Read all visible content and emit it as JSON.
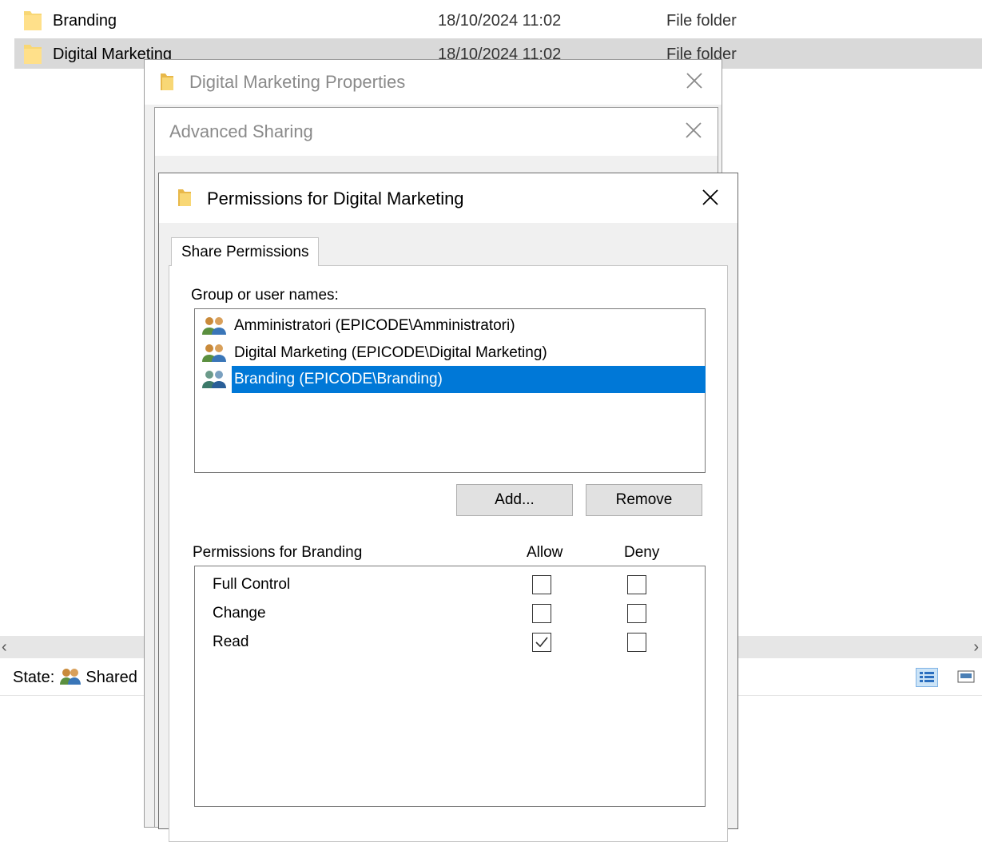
{
  "explorer": {
    "files": [
      {
        "name": "Branding",
        "date": "18/10/2024 11:02",
        "type": "File folder",
        "selected": false
      },
      {
        "name": "Digital Marketing",
        "date": "18/10/2024 11:02",
        "type": "File folder",
        "selected": true
      }
    ],
    "status": {
      "state_label": "State:",
      "state_value": "Shared"
    }
  },
  "properties_dialog": {
    "title": "Digital Marketing Properties"
  },
  "advanced_sharing_dialog": {
    "title": "Advanced Sharing"
  },
  "permissions_dialog": {
    "title": "Permissions for Digital Marketing",
    "tab": "Share Permissions",
    "group_label": "Group or user names:",
    "users": [
      {
        "name": "Amministratori (EPICODE\\Amministratori)",
        "selected": false
      },
      {
        "name": "Digital Marketing (EPICODE\\Digital Marketing)",
        "selected": false
      },
      {
        "name": "Branding (EPICODE\\Branding)",
        "selected": true
      }
    ],
    "add_button": "Add...",
    "remove_button": "Remove",
    "permissions_label": "Permissions for Branding",
    "allow_label": "Allow",
    "deny_label": "Deny",
    "permissions": [
      {
        "name": "Full Control",
        "allow": false,
        "deny": false
      },
      {
        "name": "Change",
        "allow": false,
        "deny": false
      },
      {
        "name": "Read",
        "allow": true,
        "deny": false
      }
    ]
  },
  "colors": {
    "selection": "#0078d7",
    "row_selected": "#d9d9d9",
    "folder": "#f8d775"
  }
}
